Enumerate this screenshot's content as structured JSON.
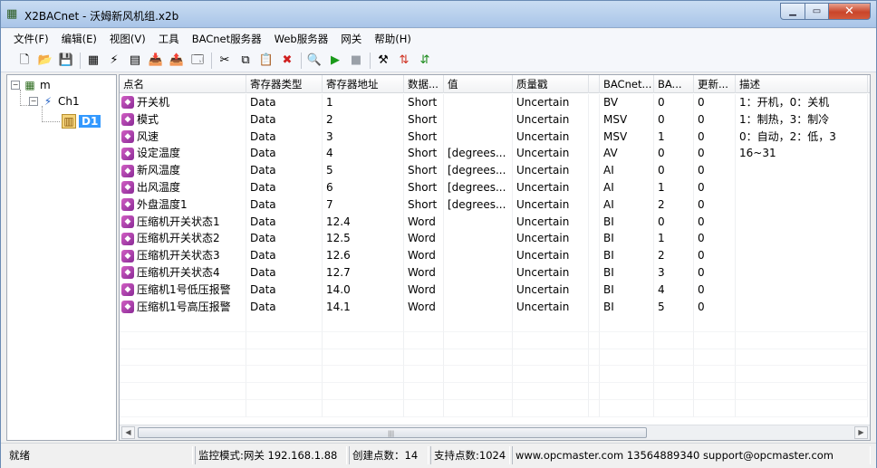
{
  "window": {
    "title": "X2BACnet - 沃姆新风机组.x2b",
    "min_glyph": "▁",
    "max_glyph": "▭",
    "close_glyph": "✕"
  },
  "menu": [
    "文件(F)",
    "编辑(E)",
    "视图(V)",
    "工具",
    "BACnet服务器",
    "Web服务器",
    "网关",
    "帮助(H)"
  ],
  "toolbar_icons": [
    {
      "name": "new-file-icon",
      "glyph": "🗋"
    },
    {
      "name": "open-folder-icon",
      "glyph": "📂"
    },
    {
      "name": "save-icon",
      "glyph": "💾"
    },
    {
      "sep": true
    },
    {
      "name": "add-device-icon",
      "glyph": "▦"
    },
    {
      "name": "add-channel-icon",
      "glyph": "⚡"
    },
    {
      "name": "add-tag-icon",
      "glyph": "▤"
    },
    {
      "name": "import-icon",
      "glyph": "📥"
    },
    {
      "name": "export-icon",
      "glyph": "📤"
    },
    {
      "name": "properties-icon",
      "glyph": "🗔"
    },
    {
      "sep": true
    },
    {
      "name": "cut-icon",
      "glyph": "✂"
    },
    {
      "name": "copy-icon",
      "glyph": "⧉"
    },
    {
      "name": "paste-icon",
      "glyph": "📋"
    },
    {
      "name": "delete-icon",
      "glyph": "✖",
      "color": "#d02020"
    },
    {
      "sep": true
    },
    {
      "name": "monitor-icon",
      "glyph": "🔍"
    },
    {
      "name": "start-icon",
      "glyph": "▶",
      "color": "#1a9a1a"
    },
    {
      "name": "stop-icon",
      "glyph": "■",
      "color": "#9aa0a8"
    },
    {
      "sep": true
    },
    {
      "name": "tools-icon",
      "glyph": "⚒"
    },
    {
      "name": "gateway-icon",
      "glyph": "⇅",
      "color": "#d03020"
    },
    {
      "name": "sync-icon",
      "glyph": "⇵",
      "color": "#1a8a1a"
    }
  ],
  "tree": {
    "root": "m",
    "channel": "Ch1",
    "device": "D1",
    "expand_glyph": "−"
  },
  "columns": [
    "点名",
    "寄存器类型",
    "寄存器地址",
    "数据...",
    "值",
    "质量戳",
    "",
    "BACnet...",
    "BA...",
    "更新...",
    "描述"
  ],
  "rows": [
    [
      "开关机",
      "Data",
      "1",
      "Short",
      "",
      "Uncertain",
      "",
      "BV",
      "0",
      "0",
      "1：开机，0：关机"
    ],
    [
      "模式",
      "Data",
      "2",
      "Short",
      "",
      "Uncertain",
      "",
      "MSV",
      "0",
      "0",
      "1：制热，3：制冷"
    ],
    [
      "风速",
      "Data",
      "3",
      "Short",
      "",
      "Uncertain",
      "",
      "MSV",
      "1",
      "0",
      "0：自动，2：低，3"
    ],
    [
      "设定温度",
      "Data",
      "4",
      "Short",
      "[degrees...",
      "Uncertain",
      "",
      "AV",
      "0",
      "0",
      "16~31"
    ],
    [
      "新风温度",
      "Data",
      "5",
      "Short",
      "[degrees...",
      "Uncertain",
      "",
      "AI",
      "0",
      "0",
      ""
    ],
    [
      "出风温度",
      "Data",
      "6",
      "Short",
      "[degrees...",
      "Uncertain",
      "",
      "AI",
      "1",
      "0",
      ""
    ],
    [
      "外盘温度1",
      "Data",
      "7",
      "Short",
      "[degrees...",
      "Uncertain",
      "",
      "AI",
      "2",
      "0",
      ""
    ],
    [
      "压缩机开关状态1",
      "Data",
      "12.4",
      "Word",
      "",
      "Uncertain",
      "",
      "BI",
      "0",
      "0",
      ""
    ],
    [
      "压缩机开关状态2",
      "Data",
      "12.5",
      "Word",
      "",
      "Uncertain",
      "",
      "BI",
      "1",
      "0",
      ""
    ],
    [
      "压缩机开关状态3",
      "Data",
      "12.6",
      "Word",
      "",
      "Uncertain",
      "",
      "BI",
      "2",
      "0",
      ""
    ],
    [
      "压缩机开关状态4",
      "Data",
      "12.7",
      "Word",
      "",
      "Uncertain",
      "",
      "BI",
      "3",
      "0",
      ""
    ],
    [
      "压缩机1号低压报警",
      "Data",
      "14.0",
      "Word",
      "",
      "Uncertain",
      "",
      "BI",
      "4",
      "0",
      ""
    ],
    [
      "压缩机1号高压报警",
      "Data",
      "14.1",
      "Word",
      "",
      "Uncertain",
      "",
      "BI",
      "5",
      "0",
      ""
    ]
  ],
  "scrollbar": {
    "left": "◀",
    "right": "▶",
    "grip": "|||"
  },
  "status": {
    "ready": "就绪",
    "mode": "监控模式:网关 192.168.1.88",
    "created": "创建点数：14",
    "supported": "支持点数:1024",
    "contact": "www.opcmaster.com 13564889340 support@opcmaster.com"
  }
}
